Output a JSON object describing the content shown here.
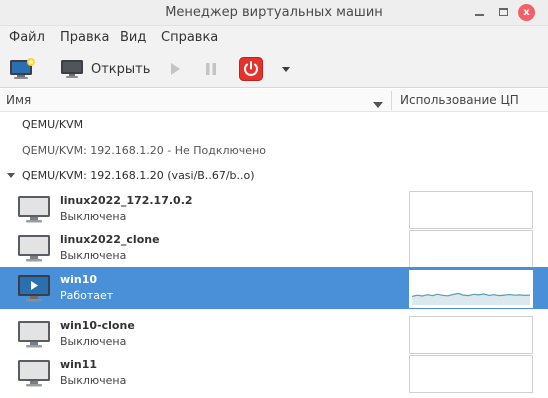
{
  "window": {
    "title": "Менеджер виртуальных машин",
    "close_glyph": "x"
  },
  "menu": {
    "items": [
      "Файл",
      "Правка",
      "Вид",
      "Справка"
    ]
  },
  "toolbar": {
    "new_vm_icon": "new-vm-icon",
    "open_label": "Открыть",
    "open_icon": "monitor-icon",
    "run_icon": "play-icon",
    "pause_icon": "pause-icon",
    "shutdown_icon": "power-icon",
    "shutdown_menu_icon": "dropdown-arrow-icon",
    "shutdown_color": "#e5322d"
  },
  "columns": {
    "name": "Имя",
    "cpu": "Использование ЦП"
  },
  "connections": [
    {
      "label": "QEMU/KVM",
      "state": "default"
    },
    {
      "label": "QEMU/KVM: 192.168.1.20 - Не Подключено",
      "state": "disconnected"
    },
    {
      "label": "QEMU/KVM: 192.168.1.20 (vasi/B..67/b..o)",
      "state": "expanded"
    }
  ],
  "vms": [
    {
      "name": "linux2022_172.17.0.2",
      "status": "Выключена",
      "selected": false
    },
    {
      "name": "linux2022_clone",
      "status": "Выключена",
      "selected": false
    },
    {
      "name": "win10",
      "status": "Работает",
      "selected": true,
      "cpu_usage_samples": [
        0.25,
        0.32,
        0.28,
        0.35,
        0.3,
        0.38,
        0.31,
        0.29,
        0.36,
        0.42,
        0.33,
        0.3,
        0.37,
        0.34,
        0.39,
        0.31,
        0.35,
        0.3,
        0.33,
        0.36,
        0.32,
        0.34,
        0.31,
        0.33
      ]
    },
    {
      "name": "win10-clone",
      "status": "Выключена",
      "selected": false
    },
    {
      "name": "win11",
      "status": "Выключена",
      "selected": false
    }
  ],
  "colors": {
    "selection": "#4a90d9",
    "cpu_line": "#5a9fb0"
  }
}
